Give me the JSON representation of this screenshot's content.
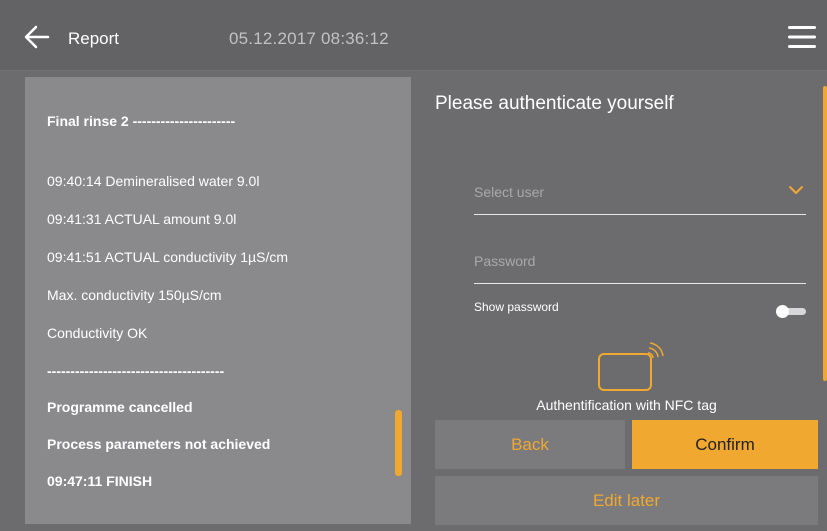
{
  "header": {
    "title": "Report",
    "datetime": "05.12.2017  08:36:12"
  },
  "report": {
    "lines": [
      {
        "text": "Final rinse 2 ----------------------",
        "bold": true
      },
      {
        "text": "09:40:14 Demineralised water 9.0l",
        "bold": false
      },
      {
        "text": "09:41:31 ACTUAL amount 9.0l",
        "bold": false
      },
      {
        "text": "09:41:51 ACTUAL conductivity 1µS/cm",
        "bold": false
      },
      {
        "text": "Max. conductivity 150µS/cm",
        "bold": false
      },
      {
        "text": "Conductivity OK",
        "bold": false
      },
      {
        "text": "--------------------------------------",
        "bold": true
      },
      {
        "text": "Programme cancelled",
        "bold": true
      },
      {
        "text": "Process parameters not achieved",
        "bold": true
      },
      {
        "text": "09:47:11 FINISH",
        "bold": true
      }
    ]
  },
  "auth": {
    "title": "Please authenticate yourself",
    "select_user_placeholder": "Select user",
    "password_placeholder": "Password",
    "show_password_label": "Show password",
    "show_password_on": false,
    "nfc_label": "Authentification with NFC tag"
  },
  "buttons": {
    "back": "Back",
    "confirm": "Confirm",
    "edit_later": "Edit later"
  },
  "icons": {
    "back": "arrow-left-icon",
    "menu": "hamburger-menu-icon",
    "dropdown": "chevron-down-icon",
    "nfc": "nfc-tag-icon"
  },
  "colors": {
    "accent": "#f0a830",
    "background": "#6c6c6e",
    "panel": "#8a8a8c",
    "button": "#7b7b7d"
  }
}
